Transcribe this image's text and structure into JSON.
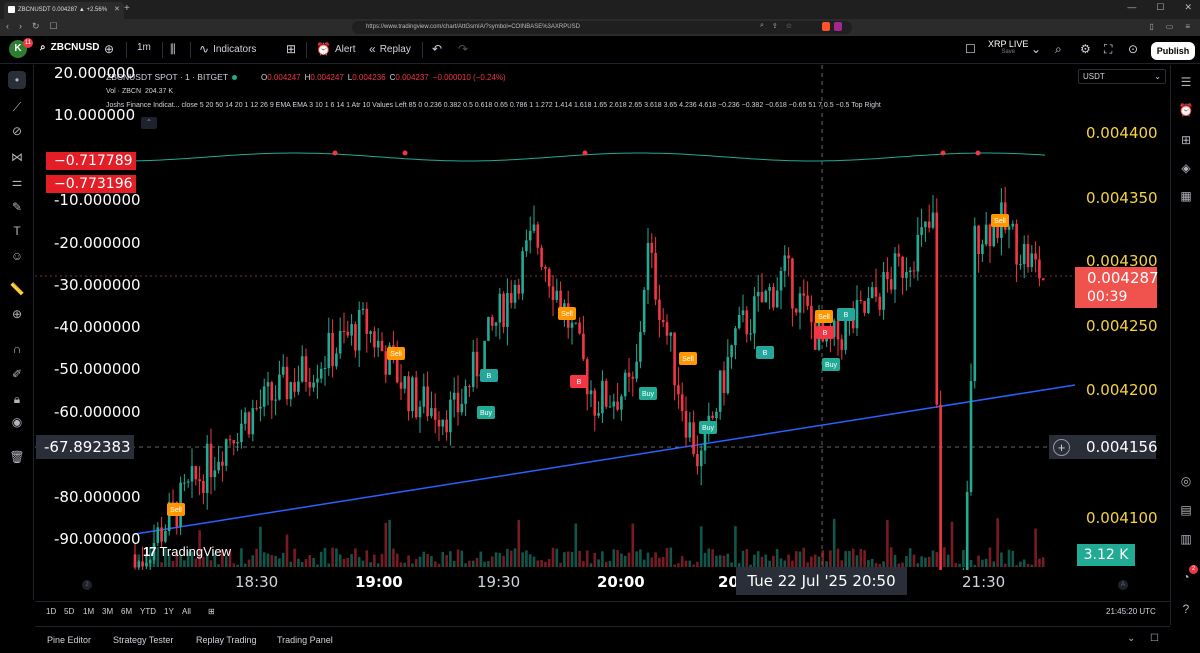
{
  "browser": {
    "tab_title": "ZBCNUSDT 0.004287 ▲ +2.56%",
    "url": "https://www.tradingview.com/chart/AttGsmIA/?symbol=COINBASE%3AXRPUSD"
  },
  "toolbar": {
    "avatar_letter": "K",
    "avatar_badge": "11",
    "symbol": "ZBCNUSD",
    "interval": "1m",
    "indicators_label": "Indicators",
    "alert_label": "Alert",
    "replay_label": "Replay",
    "layout_name": "XRP LIVE",
    "layout_status": "Save",
    "publish_label": "Publish"
  },
  "legend": {
    "symbol_title": "ZBCNUSDT SPOT · 1 · BITGET",
    "o_label": "O",
    "o_value": "0.004247",
    "h_label": "H",
    "h_value": "0.004247",
    "l_label": "L",
    "l_value": "0.004236",
    "c_label": "C",
    "c_value": "0.004237",
    "change": "−0.000010 (−0.24%)",
    "vol_label": "Vol · ZBCN",
    "vol_value": "204.37 K",
    "indicator_text": "Joshs Finance Indicat...  close 5 20 50 14 20 1 12 26 9 EMA EMA 3 10 1 6 14 1 Atr 10 Values Left 85 0 0.236 0.382 0.5 0.618 0.65 0.786 1 1.272 1.414 1.618 1.65 2.618 2.65 3.618 3.65 4.236 4.618 −0.236 −0.382 −0.618 −0.65 51 7 0.5 −0.5 Top Right"
  },
  "left_scale": {
    "labels": [
      "20.000000",
      "10.000000",
      "-10.000000",
      "-20.000000",
      "-30.000000",
      "-40.000000",
      "-50.000000",
      "-60.000000",
      "-80.000000",
      "-90.000000"
    ],
    "badge_1": "−0.717789",
    "badge_2": "−0.773196",
    "crosshair_value": "-67.892383"
  },
  "right_scale": {
    "currency": "USDT",
    "labels": [
      "0.004400",
      "0.004350",
      "0.004300",
      "0.004250",
      "0.004200",
      "0.004100"
    ],
    "last_price": "0.004287",
    "countdown": "00:39",
    "crosshair_price": "0.004156",
    "volume_tag": "3.12 K"
  },
  "time_axis": {
    "labels": [
      "18:30",
      "19:00",
      "19:30",
      "20:00",
      "20",
      "21:30"
    ],
    "crosshair_time": "Tue 22 Jul '25   20:50",
    "scale_mode_left": "2",
    "scale_mode_right": "A"
  },
  "signals": {
    "sell": "Sell",
    "buy": "Buy",
    "b": "B"
  },
  "watermark": "TradingView",
  "range_bar": {
    "ranges": [
      "1D",
      "5D",
      "1M",
      "3M",
      "6M",
      "YTD",
      "1Y",
      "All"
    ],
    "utc": "21:45:20 UTC"
  },
  "bottom_panel": {
    "tabs": [
      "Pine Editor",
      "Strategy Tester",
      "Replay Trading",
      "Trading Panel"
    ]
  },
  "right_widgets": {
    "badge": "2"
  },
  "colors": {
    "bull": "#22ab94",
    "bear": "#f23645",
    "sell_badge": "#ff9800",
    "buy_badge": "#22ab94",
    "trend_blue": "#2962ff",
    "price_tag": "#f0534d",
    "scale_yellow": "#f5d442"
  }
}
